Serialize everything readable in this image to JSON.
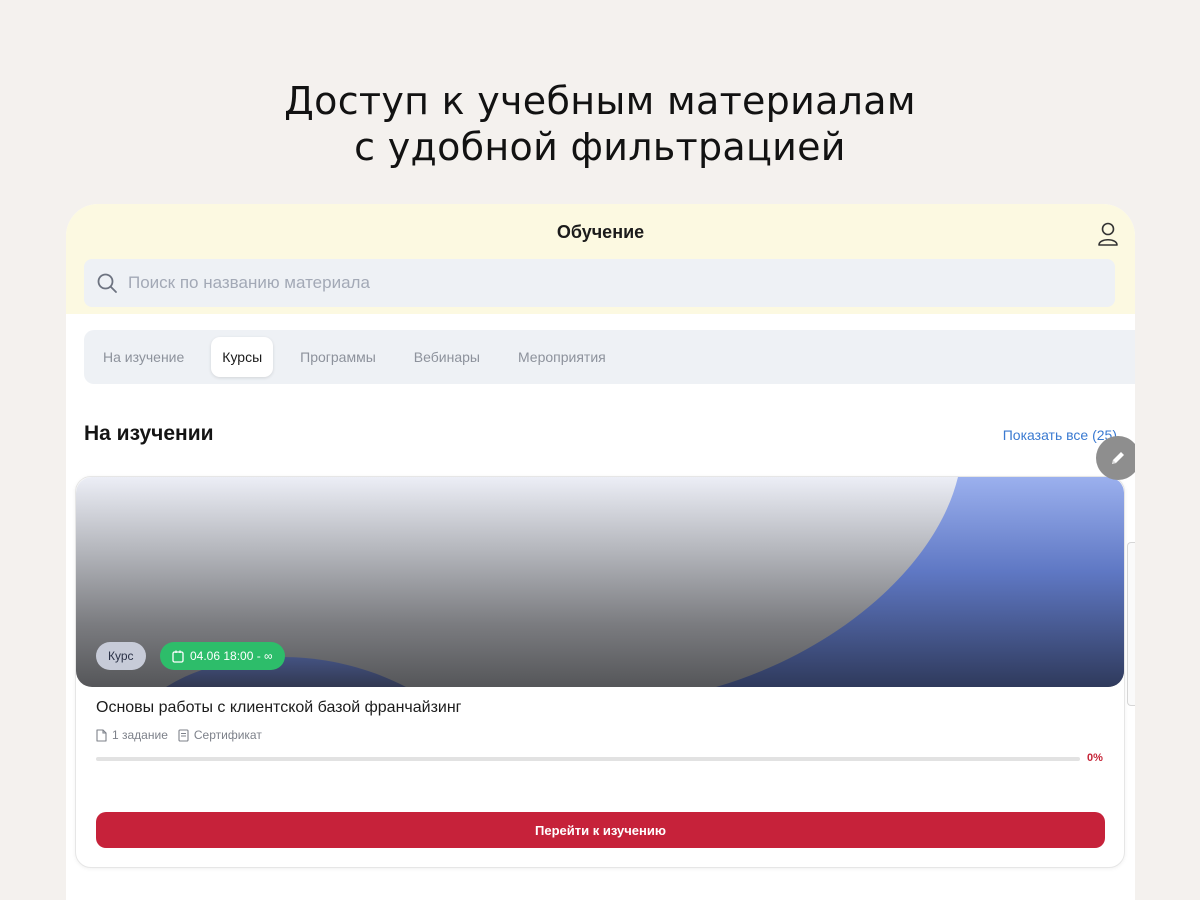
{
  "headline": {
    "line1": "Доступ к учебным материалам",
    "line2": "с удобной фильтрацией"
  },
  "app": {
    "title": "Обучение",
    "search": {
      "placeholder": "Поиск по названию материала",
      "value": ""
    },
    "tabs": [
      {
        "label": "На изучение",
        "active": false
      },
      {
        "label": "Курсы",
        "active": true
      },
      {
        "label": "Программы",
        "active": false
      },
      {
        "label": "Вебинары",
        "active": false
      },
      {
        "label": "Мероприятия",
        "active": false
      }
    ],
    "section": {
      "title": "На изучении",
      "show_all": "Показать все (25)"
    },
    "course": {
      "type_badge": "Курс",
      "date_badge": "04.06 18:00 - ∞",
      "title": "Основы работы с клиентской базой франчайзинг",
      "tasks": "1 задание",
      "certificate": "Сертификат",
      "progress_percent": 0,
      "progress_label": "0%",
      "cta": "Перейти к изучению"
    }
  },
  "colors": {
    "page_bg": "#f4f1ee",
    "topbar_bg": "#fcf9e1",
    "accent_red": "#c6223a",
    "badge_green": "#2dbd6a",
    "link_blue": "#3a7ad1",
    "cover_blue": "#5f78c4"
  }
}
